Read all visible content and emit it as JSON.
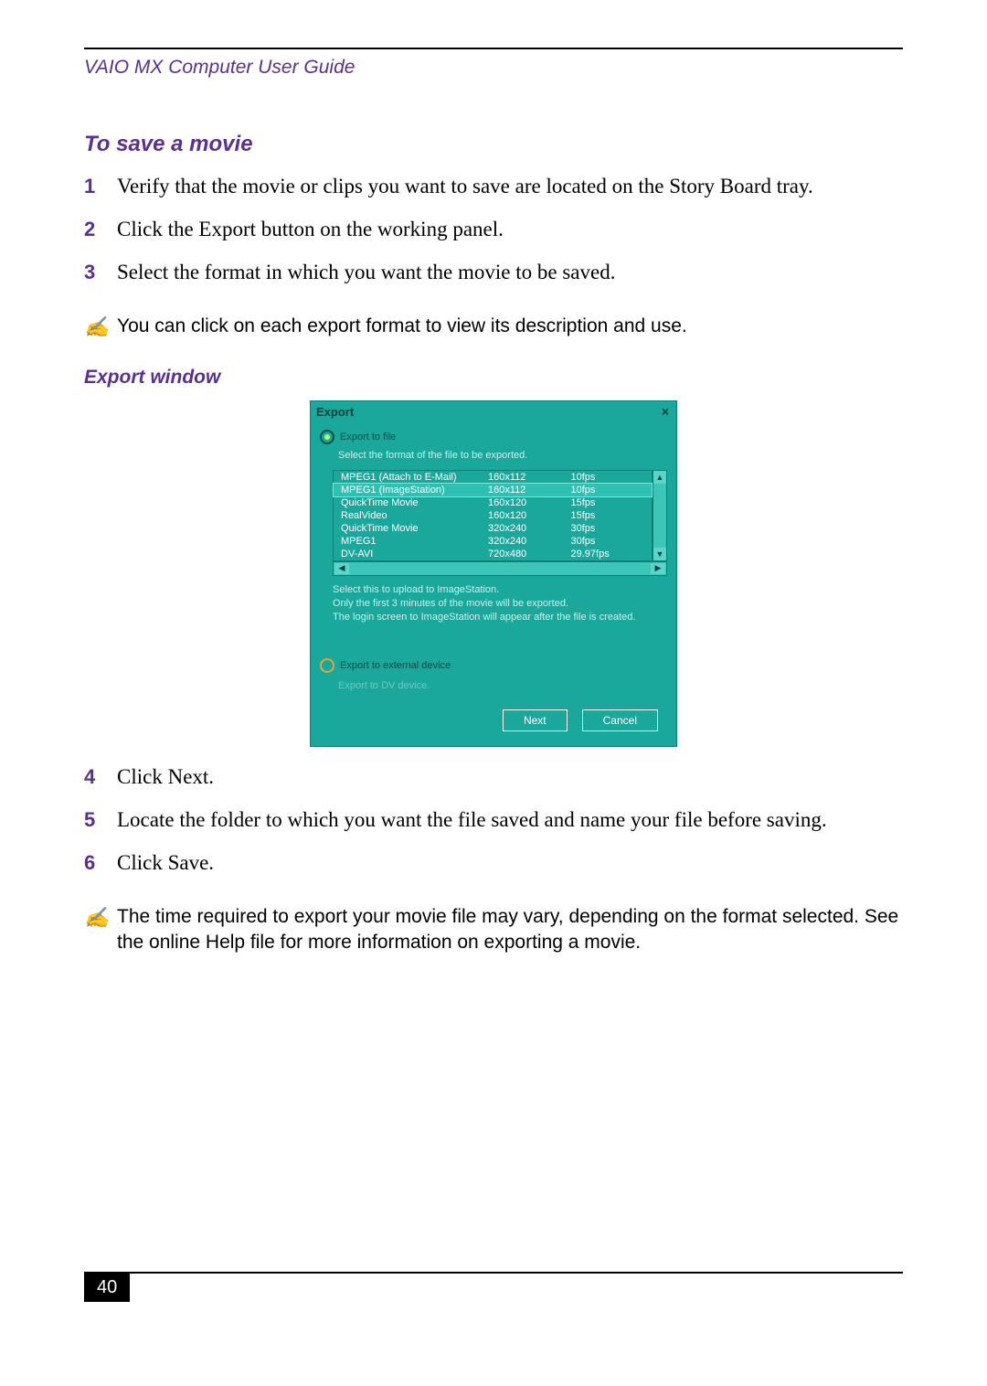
{
  "running_head": "VAIO MX Computer User Guide",
  "section_title": "To save a movie",
  "subsection_title": "Export window",
  "steps_a": [
    {
      "num": "1",
      "text": "Verify that the movie or clips you want to save are located on the Story Board tray."
    },
    {
      "num": "2",
      "text": "Click the Export button on the working panel."
    },
    {
      "num": "3",
      "text": "Select the format in which you want the movie to be saved."
    }
  ],
  "note_a": "You can click on each export format to view its description and use.",
  "steps_b": [
    {
      "num": "4",
      "text": "Click Next."
    },
    {
      "num": "5",
      "text": "Locate the folder to which you want the file saved and name your file before saving."
    },
    {
      "num": "6",
      "text": "Click Save."
    }
  ],
  "note_b": "The time required to export your movie file may vary, depending on the format selected. See the online Help file for more information on exporting a movie.",
  "page_number": "40",
  "dialog": {
    "title": "Export",
    "close": "×",
    "radio_file": "Export to file",
    "select_format": "Select the format of the file to be exported.",
    "formats": [
      {
        "name": "MPEG1 (Attach to E-Mail)",
        "res": "160x112",
        "fps": "10fps",
        "sel": false
      },
      {
        "name": "MPEG1 (ImageStation)",
        "res": "160x112",
        "fps": "10fps",
        "sel": true
      },
      {
        "name": "QuickTime Movie",
        "res": "160x120",
        "fps": "15fps",
        "sel": false
      },
      {
        "name": "RealVideo",
        "res": "160x120",
        "fps": "15fps",
        "sel": false
      },
      {
        "name": "QuickTime Movie",
        "res": "320x240",
        "fps": "30fps",
        "sel": false
      },
      {
        "name": "MPEG1",
        "res": "320x240",
        "fps": "30fps",
        "sel": false
      },
      {
        "name": "DV-AVI",
        "res": "720x480",
        "fps": "29.97fps",
        "sel": false
      }
    ],
    "desc1": "Select this to upload to ImageStation.",
    "desc2": "Only the first 3 minutes of the movie will be exported.",
    "desc3": "The login screen to ImageStation will appear after the file is created.",
    "radio_ext": "Export to external device",
    "ext_hint": "Export to DV device.",
    "next": "Next",
    "cancel": "Cancel"
  }
}
